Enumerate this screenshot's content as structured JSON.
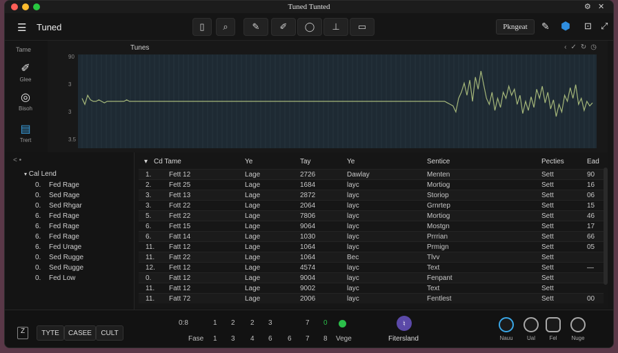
{
  "window": {
    "title": "Tuned Tunted"
  },
  "toolbar": {
    "app_title": "Tuned",
    "pro_label": "Pkngeat"
  },
  "sidebar": {
    "heading": "Tame",
    "items": [
      {
        "label": "Glee"
      },
      {
        "label": "Bisoh"
      },
      {
        "label": "Trert"
      }
    ]
  },
  "chart_data": {
    "type": "line",
    "title": "Tunes",
    "yticks": [
      "90",
      "3",
      "3",
      "3.5"
    ],
    "series": [
      {
        "values": [
          1.2,
          0.8,
          1.4,
          1.1,
          1.0,
          1.0,
          1.1,
          1.0,
          0.9,
          1.0,
          1.0,
          1.0,
          1.0,
          1.0,
          1.0,
          1.0,
          1.1,
          1.0,
          1.0,
          1.0,
          1.0,
          1.0,
          1.0,
          1.0,
          1.0,
          1.0,
          1.0,
          1.0,
          1.0,
          1.0,
          1.0,
          1.0,
          1.0,
          1.0,
          1.0,
          1.0,
          1.0,
          1.0,
          1.0,
          1.0,
          1.0,
          1.0,
          1.0,
          1.0,
          1.0,
          1.0,
          1.0,
          1.0,
          1.0,
          1.0,
          1.0,
          1.0,
          1.0,
          1.0,
          1.0,
          1.0,
          1.0,
          1.0,
          1.0,
          1.0,
          1.0,
          1.0,
          1.0,
          1.0,
          1.0,
          1.0,
          1.0,
          1.0,
          1.0,
          1.0,
          1.0,
          1.0,
          1.0,
          1.0,
          1.0,
          1.0,
          1.0,
          1.0,
          1.0,
          1.0,
          1.0,
          1.0,
          1.0,
          1.0,
          1.0,
          1.0,
          1.0,
          1.0,
          1.0,
          1.0,
          1.0,
          1.0,
          1.0,
          1.0,
          1.0,
          1.0,
          1.0,
          1.0,
          1.0,
          1.0,
          1.0,
          1.0,
          1.0,
          1.0,
          1.0,
          1.0,
          1.0,
          1.0,
          1.0,
          1.0,
          1.0,
          1.0,
          1.0,
          1.0,
          1.0,
          1.0,
          1.0,
          1.0,
          1.0,
          1.0,
          1.0,
          1.0,
          1.0,
          1.0,
          1.0,
          1.0,
          1.0,
          1.0,
          1.0,
          1.0,
          1.0,
          0.9,
          0.8,
          0.7,
          0.3,
          1.2,
          1.6,
          2.2,
          1.4,
          2.4,
          1.0,
          2.6,
          1.8,
          3.0,
          2.1,
          1.2,
          0.8,
          1.6,
          0.4,
          1.2,
          0.6,
          1.6,
          1.2,
          2.0,
          1.4,
          1.8,
          0.8,
          1.4,
          0.2,
          1.0,
          0.4,
          1.3,
          0.6,
          1.8,
          1.2,
          2.0,
          0.9,
          1.6,
          0.5,
          1.1,
          0.0,
          0.8,
          0.3,
          1.4,
          1.0,
          1.9,
          1.2,
          2.1,
          0.8,
          1.2,
          0.4,
          1.0,
          0.7,
          0.9
        ]
      }
    ]
  },
  "tree": {
    "nav": "< •",
    "root": "Cal Lend",
    "items": [
      {
        "num": "0.",
        "label": "Fed Rage"
      },
      {
        "num": "0.",
        "label": "Sed Rage"
      },
      {
        "num": "0.",
        "label": "Sed Rhgar"
      },
      {
        "num": "6.",
        "label": "Fed Rage"
      },
      {
        "num": "6.",
        "label": "Fed Rage"
      },
      {
        "num": "6.",
        "label": "Fed Rage"
      },
      {
        "num": "6.",
        "label": "Fed Urage"
      },
      {
        "num": "0.",
        "label": "Sed Rugge"
      },
      {
        "num": "0.",
        "label": "Sed Rugge"
      },
      {
        "num": "0.",
        "label": "Fed Low"
      }
    ]
  },
  "table": {
    "headers": [
      "Cd Tame",
      "Ye",
      "Tay",
      "Ye",
      "Sentice",
      "Pecties",
      "Ead"
    ],
    "rows": [
      [
        "1.",
        "Fett 12",
        "Lage",
        "2726",
        "Dawlay",
        "Menten",
        "Sett",
        "90"
      ],
      [
        "2.",
        "Fett 25",
        "Lage",
        "1684",
        "layc",
        "Mortiog",
        "Sett",
        "16"
      ],
      [
        "3.",
        "Fett 13",
        "Lage",
        "2872",
        "layc",
        "Storiop",
        "Sett",
        "06"
      ],
      [
        "3.",
        "Fott 22",
        "Lage",
        "2064",
        "layc",
        "Grnrtep",
        "Sett",
        "15"
      ],
      [
        "5.",
        "Fett 22",
        "Lage",
        "7806",
        "layc",
        "Mortiog",
        "Sett",
        "46"
      ],
      [
        "6.",
        "Fett 15",
        "Lage",
        "9064",
        "layc",
        "Mostgn",
        "Sett",
        "17"
      ],
      [
        "6.",
        "Fatt 14",
        "Lage",
        "1030",
        "layc",
        "Prrrian",
        "Sett",
        "66"
      ],
      [
        "11.",
        "Fatt 12",
        "Lage",
        "1064",
        "layc",
        "Prmign",
        "Sett",
        "05"
      ],
      [
        "11.",
        "Fatt 22",
        "Lage",
        "1064",
        "Bec",
        "Tlvv",
        "Sett",
        ""
      ],
      [
        "12.",
        "Fett 12",
        "Lage",
        "4574",
        "layc",
        "Text",
        "Sett",
        "—"
      ],
      [
        "0.",
        "Fatt 12",
        "Lage",
        "9004",
        "layc",
        "Fenpant",
        "Sett",
        ""
      ],
      [
        "11.",
        "Fatt 12",
        "Lage",
        "9002",
        "layc",
        "Text",
        "Sett",
        ""
      ],
      [
        "11.",
        "Fatt 72",
        "Lage",
        "2006",
        "layc",
        "Fentlest",
        "Sett",
        "00"
      ]
    ]
  },
  "bottom": {
    "buttons": [
      "TYTE",
      "CASEE",
      "CULT"
    ],
    "page_top": [
      "0:8",
      "1",
      "2",
      "2",
      "3",
      "7",
      "0"
    ],
    "page_bottom": [
      "Fase",
      "1",
      "3",
      "4",
      "6",
      "6",
      "7",
      "8",
      "Vege"
    ],
    "center_label": "Fitersland",
    "knobs": [
      "Nauu",
      "Ual",
      "Fel",
      "Nuge"
    ],
    "accent": "#2bbf4a",
    "purple": "#5b49a8",
    "knob_accent": "#3aa8e8"
  }
}
